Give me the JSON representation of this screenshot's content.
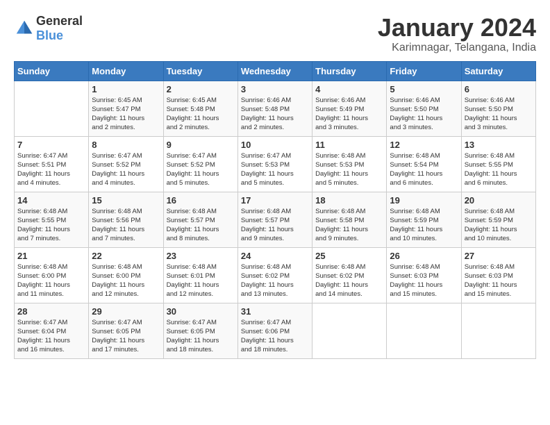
{
  "header": {
    "logo_general": "General",
    "logo_blue": "Blue",
    "month": "January 2024",
    "location": "Karimnagar, Telangana, India"
  },
  "days_of_week": [
    "Sunday",
    "Monday",
    "Tuesday",
    "Wednesday",
    "Thursday",
    "Friday",
    "Saturday"
  ],
  "weeks": [
    [
      {
        "day": "",
        "info": ""
      },
      {
        "day": "1",
        "info": "Sunrise: 6:45 AM\nSunset: 5:47 PM\nDaylight: 11 hours\nand 2 minutes."
      },
      {
        "day": "2",
        "info": "Sunrise: 6:45 AM\nSunset: 5:48 PM\nDaylight: 11 hours\nand 2 minutes."
      },
      {
        "day": "3",
        "info": "Sunrise: 6:46 AM\nSunset: 5:48 PM\nDaylight: 11 hours\nand 2 minutes."
      },
      {
        "day": "4",
        "info": "Sunrise: 6:46 AM\nSunset: 5:49 PM\nDaylight: 11 hours\nand 3 minutes."
      },
      {
        "day": "5",
        "info": "Sunrise: 6:46 AM\nSunset: 5:50 PM\nDaylight: 11 hours\nand 3 minutes."
      },
      {
        "day": "6",
        "info": "Sunrise: 6:46 AM\nSunset: 5:50 PM\nDaylight: 11 hours\nand 3 minutes."
      }
    ],
    [
      {
        "day": "7",
        "info": "Sunrise: 6:47 AM\nSunset: 5:51 PM\nDaylight: 11 hours\nand 4 minutes."
      },
      {
        "day": "8",
        "info": "Sunrise: 6:47 AM\nSunset: 5:52 PM\nDaylight: 11 hours\nand 4 minutes."
      },
      {
        "day": "9",
        "info": "Sunrise: 6:47 AM\nSunset: 5:52 PM\nDaylight: 11 hours\nand 5 minutes."
      },
      {
        "day": "10",
        "info": "Sunrise: 6:47 AM\nSunset: 5:53 PM\nDaylight: 11 hours\nand 5 minutes."
      },
      {
        "day": "11",
        "info": "Sunrise: 6:48 AM\nSunset: 5:53 PM\nDaylight: 11 hours\nand 5 minutes."
      },
      {
        "day": "12",
        "info": "Sunrise: 6:48 AM\nSunset: 5:54 PM\nDaylight: 11 hours\nand 6 minutes."
      },
      {
        "day": "13",
        "info": "Sunrise: 6:48 AM\nSunset: 5:55 PM\nDaylight: 11 hours\nand 6 minutes."
      }
    ],
    [
      {
        "day": "14",
        "info": "Sunrise: 6:48 AM\nSunset: 5:55 PM\nDaylight: 11 hours\nand 7 minutes."
      },
      {
        "day": "15",
        "info": "Sunrise: 6:48 AM\nSunset: 5:56 PM\nDaylight: 11 hours\nand 7 minutes."
      },
      {
        "day": "16",
        "info": "Sunrise: 6:48 AM\nSunset: 5:57 PM\nDaylight: 11 hours\nand 8 minutes."
      },
      {
        "day": "17",
        "info": "Sunrise: 6:48 AM\nSunset: 5:57 PM\nDaylight: 11 hours\nand 9 minutes."
      },
      {
        "day": "18",
        "info": "Sunrise: 6:48 AM\nSunset: 5:58 PM\nDaylight: 11 hours\nand 9 minutes."
      },
      {
        "day": "19",
        "info": "Sunrise: 6:48 AM\nSunset: 5:59 PM\nDaylight: 11 hours\nand 10 minutes."
      },
      {
        "day": "20",
        "info": "Sunrise: 6:48 AM\nSunset: 5:59 PM\nDaylight: 11 hours\nand 10 minutes."
      }
    ],
    [
      {
        "day": "21",
        "info": "Sunrise: 6:48 AM\nSunset: 6:00 PM\nDaylight: 11 hours\nand 11 minutes."
      },
      {
        "day": "22",
        "info": "Sunrise: 6:48 AM\nSunset: 6:00 PM\nDaylight: 11 hours\nand 12 minutes."
      },
      {
        "day": "23",
        "info": "Sunrise: 6:48 AM\nSunset: 6:01 PM\nDaylight: 11 hours\nand 12 minutes."
      },
      {
        "day": "24",
        "info": "Sunrise: 6:48 AM\nSunset: 6:02 PM\nDaylight: 11 hours\nand 13 minutes."
      },
      {
        "day": "25",
        "info": "Sunrise: 6:48 AM\nSunset: 6:02 PM\nDaylight: 11 hours\nand 14 minutes."
      },
      {
        "day": "26",
        "info": "Sunrise: 6:48 AM\nSunset: 6:03 PM\nDaylight: 11 hours\nand 15 minutes."
      },
      {
        "day": "27",
        "info": "Sunrise: 6:48 AM\nSunset: 6:03 PM\nDaylight: 11 hours\nand 15 minutes."
      }
    ],
    [
      {
        "day": "28",
        "info": "Sunrise: 6:47 AM\nSunset: 6:04 PM\nDaylight: 11 hours\nand 16 minutes."
      },
      {
        "day": "29",
        "info": "Sunrise: 6:47 AM\nSunset: 6:05 PM\nDaylight: 11 hours\nand 17 minutes."
      },
      {
        "day": "30",
        "info": "Sunrise: 6:47 AM\nSunset: 6:05 PM\nDaylight: 11 hours\nand 18 minutes."
      },
      {
        "day": "31",
        "info": "Sunrise: 6:47 AM\nSunset: 6:06 PM\nDaylight: 11 hours\nand 18 minutes."
      },
      {
        "day": "",
        "info": ""
      },
      {
        "day": "",
        "info": ""
      },
      {
        "day": "",
        "info": ""
      }
    ]
  ]
}
